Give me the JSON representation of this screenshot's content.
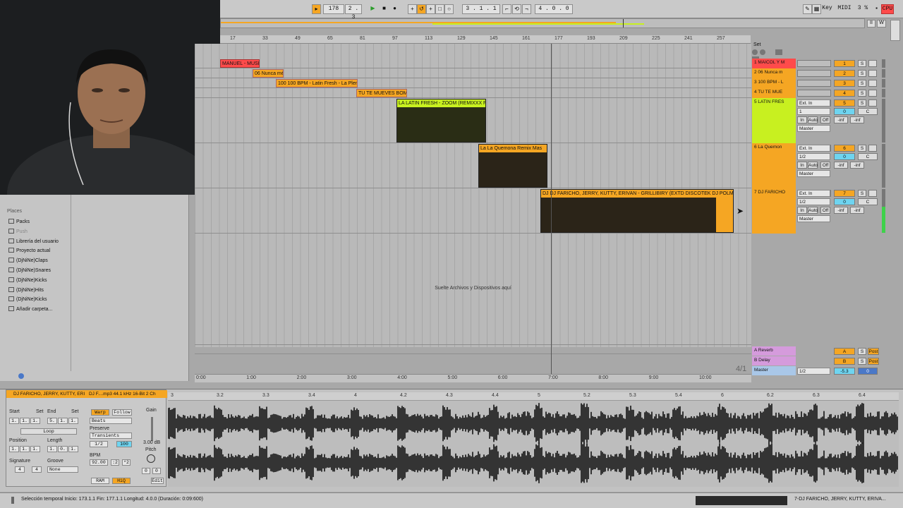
{
  "transport": {
    "tempo": "178",
    "signature": "2 . 3",
    "position": "3 .   1 .   1",
    "loop_length": "4 .   0 .   0",
    "midi_label": "MIDI",
    "key_label": "Key",
    "cpu_percent": "3 %",
    "cpu_label": "CPU"
  },
  "ruler": {
    "bars": [
      "17",
      "33",
      "49",
      "65",
      "81",
      "97",
      "113",
      "129",
      "145",
      "161",
      "177",
      "193",
      "209",
      "225",
      "241",
      "257"
    ]
  },
  "set_label": "Set",
  "tracks": [
    {
      "num": "1",
      "name": "1 MAICOL Y M",
      "clip": "MANUEL - MUSIC",
      "color": "#ff4b4b"
    },
    {
      "num": "2",
      "name": "2 06 Nunca m",
      "clip": "06 Nunca mé",
      "color": "#f5a623"
    },
    {
      "num": "3",
      "name": "3 100 BPM - L",
      "clip": "100  100 BPM - Latin Fresh - La Plen",
      "color": "#f5a623"
    },
    {
      "num": "4",
      "name": "4 TU TE MUE",
      "clip": "TU TE MUEVES  BOMB",
      "color": "#f5a623"
    },
    {
      "num": "5",
      "name": "5 LATIN FRES",
      "clip": "LA  LATIN FRESH - ZOOM (REMIXXX FUL",
      "color": "#c8f020"
    },
    {
      "num": "6",
      "name": "6 La Quemon",
      "clip": "La   La Quemona Remix   Mas",
      "color": "#f5a623"
    },
    {
      "num": "7",
      "name": "7 DJ FARICHO",
      "clip": "DJ  DJ FARICHO, JERRY, KUTTY, ERIVAN - GRILLIBIRY (EXTD DISCOTEK DJ POLMIX & JE",
      "color": "#f5a623"
    }
  ],
  "io": {
    "ext_in": "Ext. In",
    "ch1": "1",
    "ch12": "1/2",
    "master": "Master",
    "in": "In",
    "auto": "Auto",
    "off": "Off",
    "inf": "-inf",
    "zero": "0",
    "c": "C",
    "s": "S"
  },
  "returns": [
    {
      "name": "A Reverb",
      "letter": "A",
      "send": "Post",
      "color": "#d59bdc"
    },
    {
      "name": "B Delay",
      "letter": "B",
      "send": "Post",
      "color": "#d59bdc"
    },
    {
      "name": "Master",
      "letter": "",
      "send": "",
      "color": "#a9c7e8"
    }
  ],
  "master_row": {
    "out": "1/2",
    "vol": "-5.3",
    "pan": "0"
  },
  "drop_hint": "Suelte Archivos y Dispositivos aquí",
  "time_ruler": [
    "0:00",
    "1:00",
    "2:00",
    "3:00",
    "4:00",
    "5:00",
    "6:00",
    "7:00",
    "8:00",
    "9:00",
    "10:00"
  ],
  "page_label": "4/1",
  "browser": {
    "places": "Places",
    "items": [
      "Packs",
      "Push",
      "Librería del usuario",
      "Proyecto actual",
      "(DjNiNe)Claps",
      "(DjNiNe)Snares",
      "(DjNiNe)Kicks",
      "(DjNiNe)Hits",
      "(DjNiNe)Kicks",
      "Añadir carpeta..."
    ]
  },
  "clip": {
    "title": "DJ FARICHO, JERRY, KUTTY, ERI",
    "file": "DJ F....mp3  44.1 kHz 16-Bit 2 Ch",
    "start_label": "Start",
    "end_label": "End",
    "set": "Set",
    "start": [
      "1.",
      "1.",
      "1."
    ],
    "end": [
      "5.",
      "1.",
      "1."
    ],
    "loop": "Loop",
    "position_label": "Position",
    "length_label": "Length",
    "position": [
      "1.",
      "1.",
      "1."
    ],
    "length": [
      "1.",
      "0.",
      "1."
    ],
    "signature_label": "Signature",
    "groove_label": "Groove",
    "sig": [
      "4",
      "4"
    ],
    "groove": "None",
    "warp": "Warp",
    "follow": "Follow",
    "beats": "Beats",
    "preserve_label": "Preserve",
    "transients": "Transients",
    "grain": "1/2",
    "grain_val": "100",
    "bpm_label": "BPM",
    "bpm": "92.00",
    "half": ":2",
    "double": "*2",
    "gain_label": "Gain",
    "gain": "3.00 dB",
    "pitch_label": "Pitch",
    "pitch": "0",
    "cents": "0",
    "ram": "RAM",
    "hiq": "HiQ",
    "edit": "Edit"
  },
  "wave_ruler": [
    "3",
    "3.2",
    "3.3",
    "3.4",
    "4",
    "4.2",
    "4.3",
    "4.4",
    "5",
    "5.2",
    "5.3",
    "5.4",
    "6",
    "6.2",
    "6.3",
    "6.4"
  ],
  "status": {
    "text": "Selección temporal   Inicio: 173.1.1   Fin: 177.1.1   Longitud: 4.0.0 (Duración: 0:09:600)",
    "track": "7-DJ FARICHO, JERRY, KUTTY, ERIVA..."
  }
}
